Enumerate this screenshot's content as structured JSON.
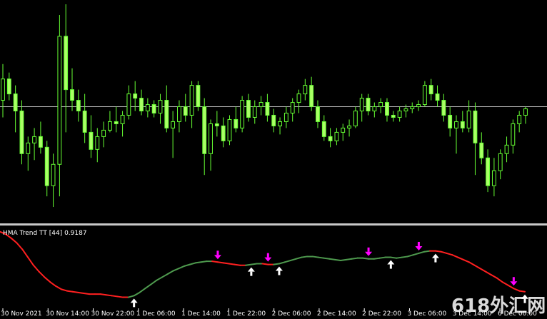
{
  "indicator": {
    "label": "HMA Trend TT [44] 0.9187",
    "colors": {
      "up": "#4e9a4e",
      "down": "#ff2020",
      "arrow_up": "#ffffff",
      "arrow_down": "#ff00ff"
    }
  },
  "watermark": {
    "text": "618外汇网"
  },
  "colors": {
    "background": "#000000",
    "candle_up_fill": "#000000",
    "candle_down_fill": "#aaff66",
    "candle_outline": "#66ff33",
    "grid_line": "#c0c0c0",
    "axis_text": "#ffffff"
  },
  "chart_data": [
    {
      "type": "candlestick",
      "title": "",
      "x_ticks": [
        "30 Nov 2021",
        "30 Nov 14:00",
        "30 Nov 22:00",
        "1 Dec 06:00",
        "1 Dec 14:00",
        "1 Dec 22:00",
        "2 Dec 06:00",
        "2 Dec 14:00",
        "2 Dec 22:00",
        "3 Dec 06:00",
        "3 Dec 14:00",
        "6 Dec 00:00"
      ],
      "ylim": [
        0,
        100
      ],
      "horizontal_line": 52,
      "grid": false,
      "candles": [
        {
          "o": 55,
          "h": 72,
          "l": 47,
          "c": 65
        },
        {
          "o": 65,
          "h": 68,
          "l": 55,
          "c": 58
        },
        {
          "o": 58,
          "h": 62,
          "l": 40,
          "c": 50
        },
        {
          "o": 50,
          "h": 55,
          "l": 25,
          "c": 30
        },
        {
          "o": 30,
          "h": 38,
          "l": 22,
          "c": 35
        },
        {
          "o": 35,
          "h": 42,
          "l": 27,
          "c": 38
        },
        {
          "o": 38,
          "h": 45,
          "l": 30,
          "c": 33
        },
        {
          "o": 33,
          "h": 36,
          "l": 10,
          "c": 15
        },
        {
          "o": 15,
          "h": 30,
          "l": 5,
          "c": 25
        },
        {
          "o": 25,
          "h": 95,
          "l": 10,
          "c": 85
        },
        {
          "o": 85,
          "h": 100,
          "l": 40,
          "c": 60
        },
        {
          "o": 60,
          "h": 70,
          "l": 50,
          "c": 55
        },
        {
          "o": 55,
          "h": 60,
          "l": 45,
          "c": 50
        },
        {
          "o": 50,
          "h": 58,
          "l": 35,
          "c": 40
        },
        {
          "o": 40,
          "h": 48,
          "l": 28,
          "c": 32
        },
        {
          "o": 32,
          "h": 42,
          "l": 26,
          "c": 38
        },
        {
          "o": 38,
          "h": 45,
          "l": 33,
          "c": 41
        },
        {
          "o": 41,
          "h": 50,
          "l": 40,
          "c": 45
        },
        {
          "o": 45,
          "h": 52,
          "l": 40,
          "c": 44
        },
        {
          "o": 44,
          "h": 50,
          "l": 38,
          "c": 48
        },
        {
          "o": 48,
          "h": 62,
          "l": 46,
          "c": 58
        },
        {
          "o": 58,
          "h": 64,
          "l": 50,
          "c": 56
        },
        {
          "o": 56,
          "h": 60,
          "l": 48,
          "c": 50
        },
        {
          "o": 50,
          "h": 56,
          "l": 47,
          "c": 53
        },
        {
          "o": 53,
          "h": 55,
          "l": 47,
          "c": 49
        },
        {
          "o": 49,
          "h": 58,
          "l": 44,
          "c": 55
        },
        {
          "o": 55,
          "h": 62,
          "l": 40,
          "c": 42
        },
        {
          "o": 42,
          "h": 50,
          "l": 28,
          "c": 45
        },
        {
          "o": 45,
          "h": 55,
          "l": 40,
          "c": 52
        },
        {
          "o": 52,
          "h": 58,
          "l": 45,
          "c": 48
        },
        {
          "o": 48,
          "h": 64,
          "l": 42,
          "c": 62
        },
        {
          "o": 62,
          "h": 64,
          "l": 50,
          "c": 52
        },
        {
          "o": 52,
          "h": 56,
          "l": 20,
          "c": 30
        },
        {
          "o": 30,
          "h": 46,
          "l": 22,
          "c": 44
        },
        {
          "o": 44,
          "h": 50,
          "l": 38,
          "c": 43
        },
        {
          "o": 43,
          "h": 47,
          "l": 33,
          "c": 36
        },
        {
          "o": 36,
          "h": 48,
          "l": 34,
          "c": 46
        },
        {
          "o": 46,
          "h": 52,
          "l": 40,
          "c": 42
        },
        {
          "o": 42,
          "h": 57,
          "l": 40,
          "c": 55
        },
        {
          "o": 55,
          "h": 58,
          "l": 45,
          "c": 47
        },
        {
          "o": 47,
          "h": 55,
          "l": 44,
          "c": 52
        },
        {
          "o": 52,
          "h": 57,
          "l": 48,
          "c": 54
        },
        {
          "o": 54,
          "h": 58,
          "l": 45,
          "c": 48
        },
        {
          "o": 48,
          "h": 51,
          "l": 40,
          "c": 43
        },
        {
          "o": 43,
          "h": 47,
          "l": 39,
          "c": 45
        },
        {
          "o": 45,
          "h": 52,
          "l": 42,
          "c": 49
        },
        {
          "o": 49,
          "h": 56,
          "l": 45,
          "c": 54
        },
        {
          "o": 54,
          "h": 60,
          "l": 49,
          "c": 58
        },
        {
          "o": 58,
          "h": 65,
          "l": 55,
          "c": 62
        },
        {
          "o": 62,
          "h": 66,
          "l": 50,
          "c": 52
        },
        {
          "o": 52,
          "h": 55,
          "l": 42,
          "c": 45
        },
        {
          "o": 45,
          "h": 48,
          "l": 36,
          "c": 38
        },
        {
          "o": 38,
          "h": 42,
          "l": 33,
          "c": 36
        },
        {
          "o": 36,
          "h": 42,
          "l": 34,
          "c": 40
        },
        {
          "o": 40,
          "h": 44,
          "l": 36,
          "c": 42
        },
        {
          "o": 42,
          "h": 46,
          "l": 38,
          "c": 43
        },
        {
          "o": 43,
          "h": 52,
          "l": 42,
          "c": 50
        },
        {
          "o": 50,
          "h": 58,
          "l": 45,
          "c": 56
        },
        {
          "o": 56,
          "h": 58,
          "l": 48,
          "c": 50
        },
        {
          "o": 50,
          "h": 54,
          "l": 47,
          "c": 52
        },
        {
          "o": 52,
          "h": 56,
          "l": 49,
          "c": 54
        },
        {
          "o": 54,
          "h": 56,
          "l": 45,
          "c": 48
        },
        {
          "o": 48,
          "h": 50,
          "l": 45,
          "c": 47
        },
        {
          "o": 47,
          "h": 52,
          "l": 45,
          "c": 50
        },
        {
          "o": 50,
          "h": 53,
          "l": 47,
          "c": 51
        },
        {
          "o": 51,
          "h": 54,
          "l": 49,
          "c": 52
        },
        {
          "o": 52,
          "h": 55,
          "l": 50,
          "c": 53
        },
        {
          "o": 53,
          "h": 64,
          "l": 52,
          "c": 62
        },
        {
          "o": 62,
          "h": 65,
          "l": 55,
          "c": 58
        },
        {
          "o": 58,
          "h": 62,
          "l": 52,
          "c": 55
        },
        {
          "o": 55,
          "h": 58,
          "l": 45,
          "c": 48
        },
        {
          "o": 48,
          "h": 52,
          "l": 38,
          "c": 42
        },
        {
          "o": 42,
          "h": 48,
          "l": 30,
          "c": 45
        },
        {
          "o": 45,
          "h": 50,
          "l": 40,
          "c": 42
        },
        {
          "o": 42,
          "h": 55,
          "l": 40,
          "c": 50
        },
        {
          "o": 50,
          "h": 54,
          "l": 20,
          "c": 35
        },
        {
          "o": 35,
          "h": 40,
          "l": 25,
          "c": 28
        },
        {
          "o": 28,
          "h": 32,
          "l": 12,
          "c": 15
        },
        {
          "o": 15,
          "h": 28,
          "l": 10,
          "c": 22
        },
        {
          "o": 22,
          "h": 32,
          "l": 18,
          "c": 30
        },
        {
          "o": 30,
          "h": 38,
          "l": 26,
          "c": 34
        },
        {
          "o": 34,
          "h": 46,
          "l": 30,
          "c": 44
        },
        {
          "o": 44,
          "h": 50,
          "l": 40,
          "c": 48
        },
        {
          "o": 48,
          "h": 52,
          "l": 44,
          "c": 51
        }
      ]
    },
    {
      "type": "line",
      "title": "HMA Trend TT [44] 0.9187",
      "ylim": [
        0,
        100
      ],
      "values": [
        94,
        91,
        86,
        80,
        72,
        62,
        52,
        44,
        37,
        31,
        26,
        22,
        20,
        19,
        18,
        17,
        16,
        16,
        16,
        15,
        14,
        13,
        12,
        12,
        14,
        18,
        23,
        28,
        33,
        37,
        41,
        45,
        48,
        51,
        53,
        55,
        56,
        57,
        57,
        56,
        55,
        54,
        53,
        52,
        52,
        53,
        54,
        54,
        53,
        53,
        54,
        56,
        58,
        60,
        62,
        63,
        63,
        62,
        61,
        60,
        59,
        58,
        59,
        60,
        61,
        61,
        60,
        60,
        61,
        62,
        62,
        61,
        62,
        63,
        65,
        67,
        69,
        70,
        70,
        69,
        67,
        65,
        62,
        59,
        56,
        52,
        48,
        44,
        40,
        36,
        31,
        27,
        23,
        20,
        19
      ],
      "trend": [
        "down",
        "down",
        "down",
        "down",
        "down",
        "down",
        "down",
        "down",
        "down",
        "down",
        "down",
        "down",
        "down",
        "down",
        "down",
        "down",
        "down",
        "down",
        "down",
        "down",
        "down",
        "down",
        "down",
        "down",
        "up",
        "up",
        "up",
        "up",
        "up",
        "up",
        "up",
        "up",
        "up",
        "up",
        "up",
        "up",
        "up",
        "up",
        "up",
        "down",
        "down",
        "down",
        "down",
        "down",
        "down",
        "up",
        "up",
        "up",
        "down",
        "down",
        "up",
        "up",
        "up",
        "up",
        "up",
        "up",
        "up",
        "up",
        "up",
        "up",
        "up",
        "up",
        "up",
        "up",
        "up",
        "up",
        "up",
        "up",
        "up",
        "up",
        "up",
        "up",
        "up",
        "up",
        "up",
        "up",
        "up",
        "up",
        "down",
        "down",
        "down",
        "down",
        "down",
        "down",
        "down",
        "down",
        "down",
        "down",
        "down",
        "down",
        "down",
        "down",
        "down",
        "down",
        "down"
      ],
      "arrows": [
        {
          "index": 24,
          "dir": "up"
        },
        {
          "index": 39,
          "dir": "down"
        },
        {
          "index": 45,
          "dir": "up"
        },
        {
          "index": 48,
          "dir": "down"
        },
        {
          "index": 50,
          "dir": "up"
        },
        {
          "index": 66,
          "dir": "down"
        },
        {
          "index": 70,
          "dir": "up"
        },
        {
          "index": 75,
          "dir": "down"
        },
        {
          "index": 78,
          "dir": "up"
        },
        {
          "index": 92,
          "dir": "down"
        },
        {
          "index": 94,
          "dir": "up"
        }
      ]
    }
  ]
}
